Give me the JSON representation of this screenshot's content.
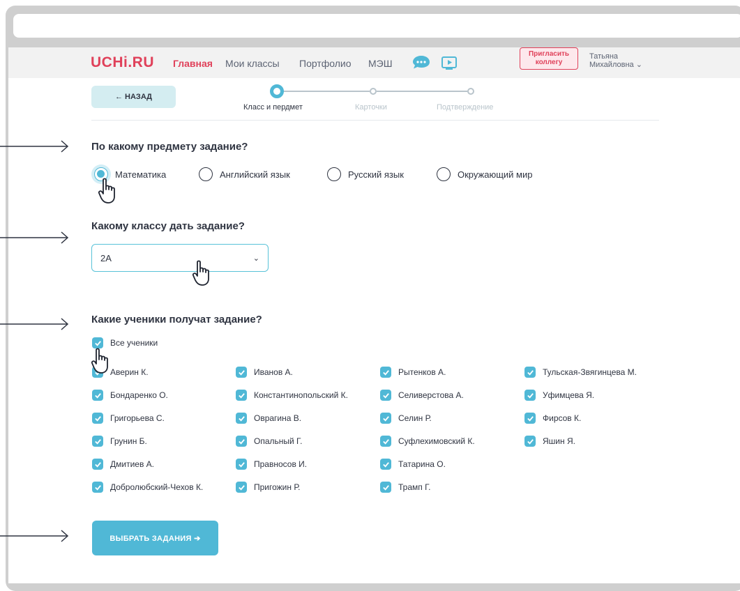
{
  "header": {
    "logo": "UCHi.RU",
    "nav": [
      "Главная",
      "Мои классы",
      "Портфолио",
      "МЭШ"
    ],
    "invite_line1": "Пригласить",
    "invite_line2": "коллегу",
    "user_line1": "Татьяна",
    "user_line2": "Михайловна ⌄"
  },
  "back_button": "← НАЗАД",
  "steps": [
    "Класс и пердмет",
    "Карточки",
    "Подтверждение"
  ],
  "subject": {
    "title": "По какому предмету задание?",
    "options": [
      "Математика",
      "Английский язык",
      "Русский язык",
      "Окружающий мир"
    ],
    "selected": "Математика"
  },
  "class_select": {
    "title": "Какому классу дать задание?",
    "value": "2А"
  },
  "students": {
    "title": "Какие ученики получат задание?",
    "all_label": "Все ученики",
    "columns": [
      [
        "Аверин К.",
        "Бондаренко О.",
        "Григорьева С.",
        "Грунин Б.",
        "Дмитиев А.",
        "Добролюбский-Чехов К."
      ],
      [
        "Иванов А.",
        "Константинопольский К.",
        "Оврагина В.",
        "Опальный Г.",
        "Правносов И.",
        "Пригожин Р."
      ],
      [
        "Рытенков А.",
        "Селиверстова А.",
        "Селин Р.",
        "Суфлехимовский К.",
        "Татарина О.",
        "Трамп Г."
      ],
      [
        "Тульская-Звягинцева М.",
        "Уфимцева Я.",
        "Фирсов К.",
        "Яшин Я."
      ]
    ]
  },
  "submit_button": "ВЫБРАТЬ ЗАДАНИЯ ➔",
  "colors": {
    "accent": "#50b8d6",
    "brand": "#e0415a",
    "text": "#2f3441"
  }
}
